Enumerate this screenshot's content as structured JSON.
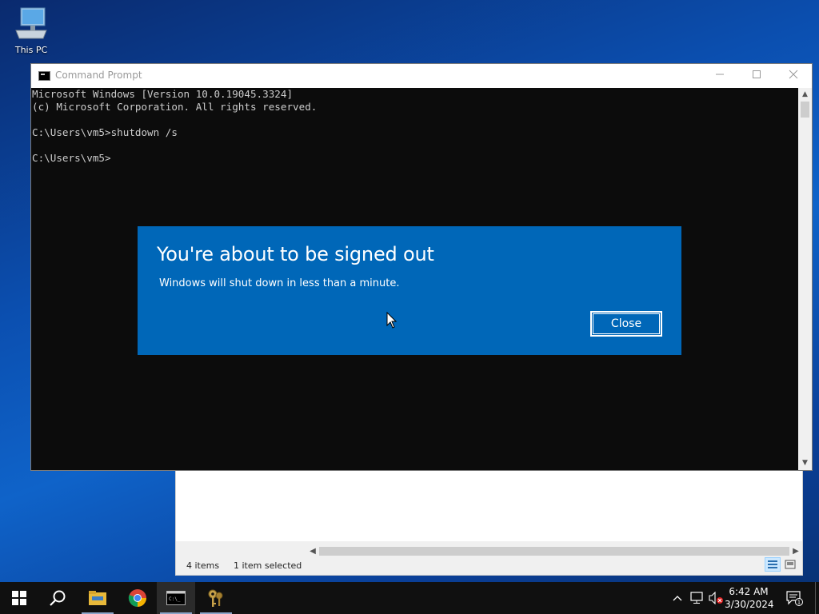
{
  "desktop": {
    "icons": [
      {
        "label": "This PC",
        "icon": "this-pc-icon"
      }
    ]
  },
  "explorer": {
    "status_items": "4 items",
    "status_selected": "1 item selected"
  },
  "cmd": {
    "title": "Command Prompt",
    "lines": [
      "Microsoft Windows [Version 10.0.19045.3324]",
      "(c) Microsoft Corporation. All rights reserved.",
      "",
      "C:\\Users\\vm5>shutdown /s",
      "",
      "C:\\Users\\vm5>"
    ]
  },
  "dialog": {
    "heading": "You're about to be signed out",
    "message": "Windows will shut down in less than a minute.",
    "close_label": "Close",
    "color": "#0067b8"
  },
  "taskbar": {
    "apps": [
      "start-icon",
      "search-icon",
      "file-explorer-icon",
      "chrome-icon",
      "command-prompt-icon",
      "keys-app-icon"
    ],
    "clock_time": "6:42 AM",
    "clock_date": "3/30/2024",
    "notification_count": "1"
  }
}
